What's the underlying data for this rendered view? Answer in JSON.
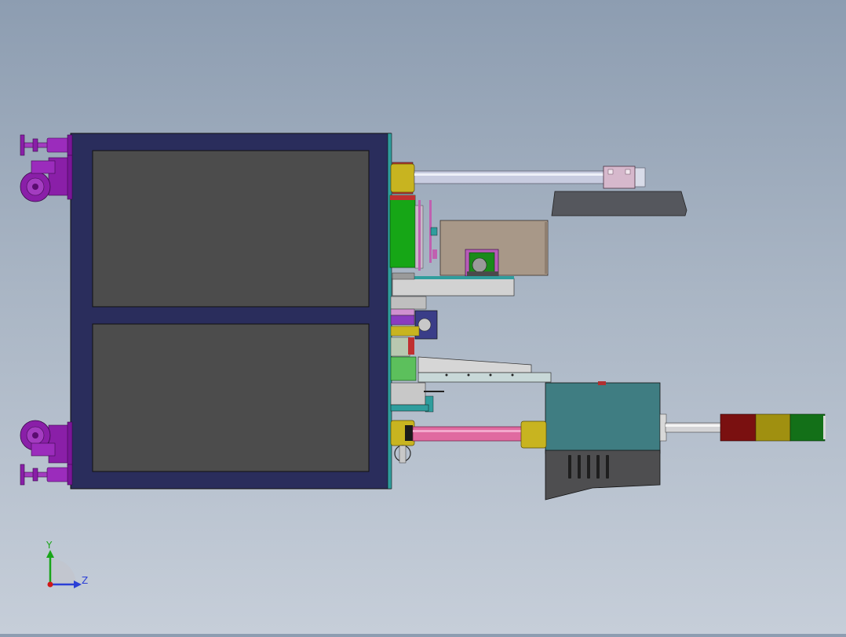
{
  "view": {
    "background_top": "#8d9db1",
    "background_bottom": "#c6ced9"
  },
  "triad": {
    "y_label": "Y",
    "z_label": "Z",
    "y_color": "#19a519",
    "z_color": "#2b3fd6",
    "origin_color": "#d01818"
  },
  "colors": {
    "frame": "#2a2d5c",
    "panel": "#4c4c4c",
    "caster": "#8a1fa8",
    "arm": "#c8cce0",
    "pad": "#55575d",
    "motor_box": "#a89888",
    "control_box": "#3f7d82",
    "control_base": "#4e4e50",
    "tube": "#e06aa0",
    "brass": "#c8b420",
    "lamp_red": "#7a1010",
    "lamp_yellow": "#a09010",
    "lamp_green": "#137018",
    "green_block": "#16a616"
  }
}
